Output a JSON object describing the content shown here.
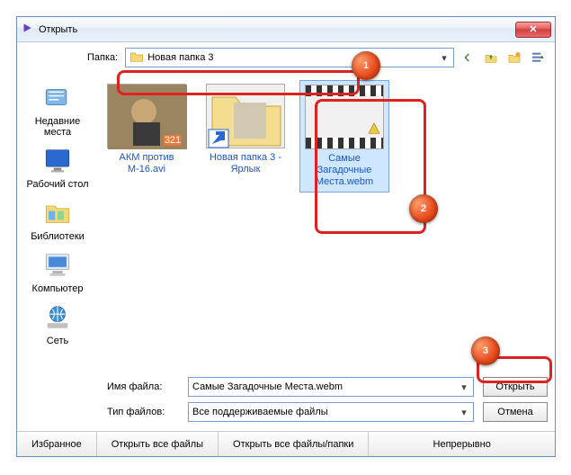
{
  "window": {
    "title": "Открыть",
    "close_glyph": "✕"
  },
  "toolbar": {
    "folder_label": "Папка:",
    "current_folder": "Новая папка 3"
  },
  "sidebar": {
    "items": [
      {
        "label": "Недавние места"
      },
      {
        "label": "Рабочий стол"
      },
      {
        "label": "Библиотеки"
      },
      {
        "label": "Компьютер"
      },
      {
        "label": "Сеть"
      }
    ]
  },
  "files": {
    "items": [
      {
        "name": "АКМ против М-16.avi"
      },
      {
        "name": "Новая папка 3 - Ярлык"
      },
      {
        "name": "Самые Загадочные Места.webm"
      }
    ]
  },
  "fields": {
    "filename_label": "Имя файла:",
    "filename_value": "Самые Загадочные Места.webm",
    "filetype_label": "Тип файлов:",
    "filetype_value": "Все поддерживаемые файлы"
  },
  "buttons": {
    "open": "Открыть",
    "cancel": "Отмена"
  },
  "bottom": {
    "items": [
      "Избранное",
      "Открыть все файлы",
      "Открыть все файлы/папки",
      "Непрерывно"
    ]
  },
  "annotations": {
    "b1": "1",
    "b2": "2",
    "b3": "3"
  }
}
